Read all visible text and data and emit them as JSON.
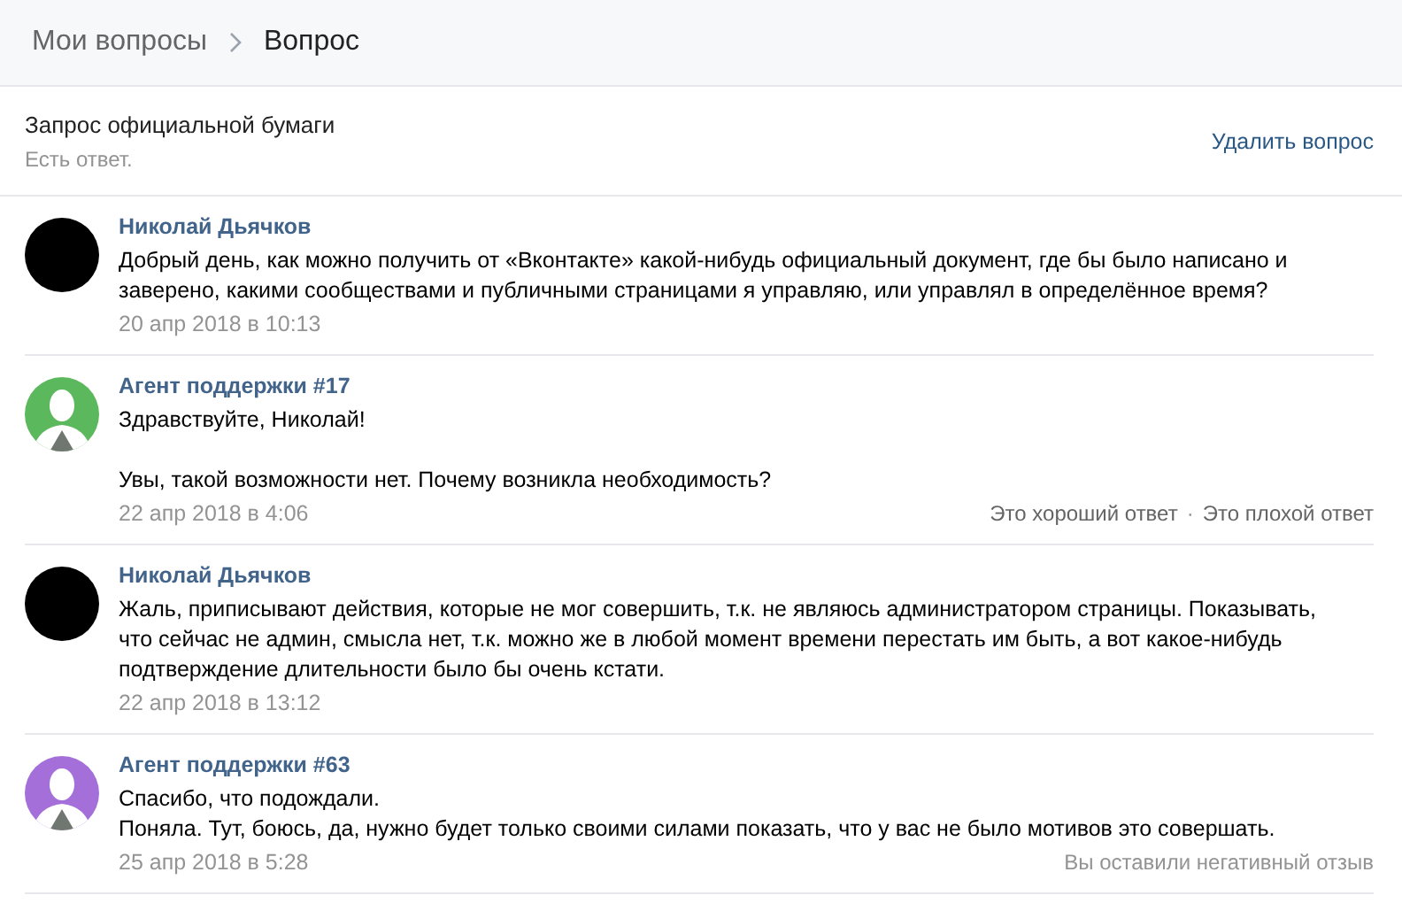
{
  "breadcrumbs": {
    "parent": "Мои вопросы",
    "current": "Вопрос"
  },
  "question": {
    "title": "Запрос официальной бумаги",
    "status": "Есть ответ.",
    "delete": "Удалить вопрос"
  },
  "messages": [
    {
      "kind": "user",
      "author": "Николай Дьячков",
      "color": "#000000",
      "text": "Добрый день, как можно получить от «Вконтакте» какой-нибудь официальный документ, где бы было написано и заверено, какими сообществами и публичными страницами я управляю, или управлял в определённое время?",
      "date": "20 апр 2018 в 10:13"
    },
    {
      "kind": "agent",
      "author": "Агент поддержки #17",
      "color": "#5cb85c",
      "text": "Здравствуйте, Николай!\n\nУвы, такой возможности нет. Почему возникла необходимость?",
      "date": "22 апр 2018 в 4:06",
      "actions": [
        "Это хороший ответ",
        "Это плохой ответ"
      ],
      "action_separator": "·"
    },
    {
      "kind": "user",
      "author": "Николай Дьячков",
      "color": "#000000",
      "text": "Жаль, приписывают действия, которые не мог совершить, т.к. не являюсь администратором страницы. Показывать, что сейчас не админ, смысла нет, т.к. можно же в любой момент времени перестать им быть, а вот какое-нибудь подтверждение длительности было бы очень кстати.",
      "date": "22 апр 2018 в 13:12"
    },
    {
      "kind": "agent",
      "author": "Агент поддержки #63",
      "color": "#a56fd9",
      "text": "Спасибо, что подождали.\nПоняла. Тут, боюсь, да, нужно будет только своими силами показать, что у вас не было мотивов это совершать.",
      "date": "25 апр 2018 в 5:28",
      "feedback": "Вы оставили негативный отзыв"
    }
  ]
}
